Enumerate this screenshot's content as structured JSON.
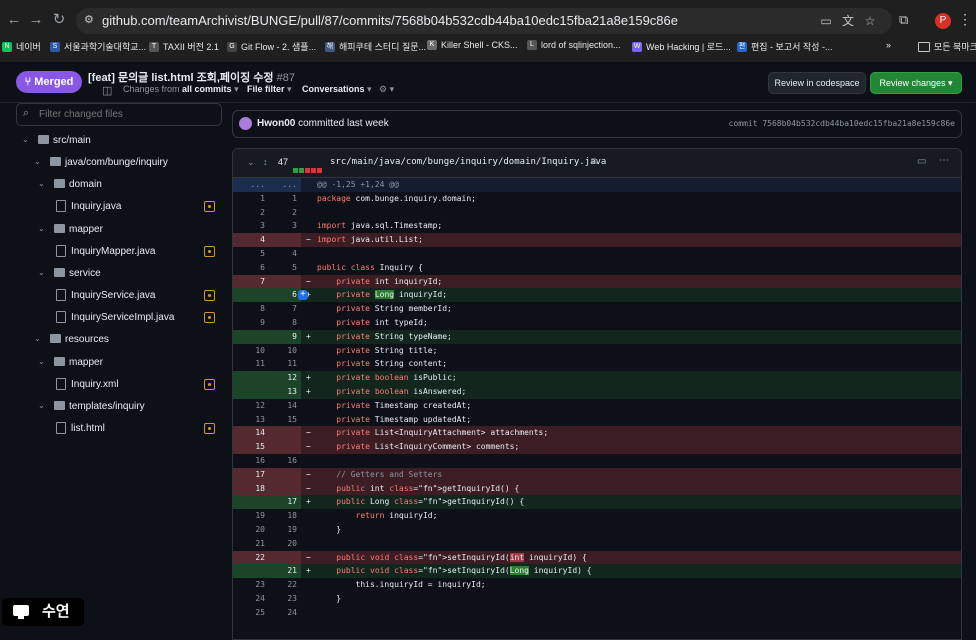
{
  "browser": {
    "url": "github.com/teamArchivist/BUNGE/pull/87/commits/7568b04b532cdb44ba10edc15fba21a8e159c86e",
    "profile_initial": "P",
    "bookmarks": [
      {
        "label": "네이버",
        "color": "#03c75a",
        "icon": "N"
      },
      {
        "label": "서울과학기술대학교...",
        "color": "#2b5aa8",
        "icon": "S"
      },
      {
        "label": "TAXII 버전 2.1",
        "color": "#555555",
        "icon": "T"
      },
      {
        "label": "Git Flow - 2. 샘플...",
        "color": "#444444",
        "icon": "G"
      },
      {
        "label": "해피쿠테 스터디 질문...",
        "color": "#3d5a80",
        "icon": "해"
      },
      {
        "label": "Killer Shell - CKS...",
        "color": "#6b6b6b",
        "icon": "K"
      },
      {
        "label": "lord of sqlinjection...",
        "color": "#555555",
        "icon": "L"
      },
      {
        "label": "Web Hacking | 로드...",
        "color": "#7b61ff",
        "icon": "W"
      },
      {
        "label": "편집 - 보고서 작성 -...",
        "color": "#1e66d0",
        "icon": "편"
      }
    ],
    "bookmarks_more": "»",
    "all_bookmarks": "모든 북마크"
  },
  "pr": {
    "status": "Merged",
    "title": "[feat] 문의글 list.html 조회,페이징 수정",
    "number": "#87",
    "changes_from_prefix": "Changes from",
    "changes_from_value": "all commits",
    "file_filter": "File filter",
    "conversations": "Conversations",
    "review_codespace": "Review in codespace",
    "review_changes": "Review changes"
  },
  "filetree": {
    "filter_placeholder": "Filter changed files",
    "items": [
      {
        "label": "src/main",
        "type": "folder",
        "depth": 0
      },
      {
        "label": "java/com/bunge/inquiry",
        "type": "folder",
        "depth": 1
      },
      {
        "label": "domain",
        "type": "folder",
        "depth": 2
      },
      {
        "label": "Inquiry.java",
        "type": "file",
        "depth": 3
      },
      {
        "label": "mapper",
        "type": "folder",
        "depth": 2
      },
      {
        "label": "InquiryMapper.java",
        "type": "file",
        "depth": 3
      },
      {
        "label": "service",
        "type": "folder",
        "depth": 2
      },
      {
        "label": "InquiryService.java",
        "type": "file",
        "depth": 3
      },
      {
        "label": "InquiryServiceImpl.java",
        "type": "file",
        "depth": 3
      },
      {
        "label": "resources",
        "type": "folder",
        "depth": 1
      },
      {
        "label": "mapper",
        "type": "folder",
        "depth": 2
      },
      {
        "label": "Inquiry.xml",
        "type": "file",
        "depth": 3
      },
      {
        "label": "templates/inquiry",
        "type": "folder",
        "depth": 2
      },
      {
        "label": "list.html",
        "type": "file",
        "depth": 3
      }
    ]
  },
  "commit": {
    "author": "Hwon00",
    "action": "committed last week",
    "sha_label": "commit 7568b04b532cdb44ba10edc15fba21a8e159c86e"
  },
  "file": {
    "change_count": "47",
    "path": "src/main/java/com/bunge/inquiry/domain/Inquiry.java",
    "colors": {
      "added": "#2ea043",
      "removed": "#da3633",
      "neutral": "#30363d"
    }
  },
  "diff": [
    {
      "t": "hunk",
      "o": "...",
      "n": "...",
      "c": "@@ -1,25 +1,24 @@"
    },
    {
      "t": "ctx",
      "o": "1",
      "n": "1",
      "c": "package com.bunge.inquiry.domain;"
    },
    {
      "t": "ctx",
      "o": "2",
      "n": "2",
      "c": ""
    },
    {
      "t": "ctx",
      "o": "3",
      "n": "3",
      "c": "import java.sql.Timestamp;"
    },
    {
      "t": "del",
      "o": "4",
      "n": "",
      "c": "import java.util.List;"
    },
    {
      "t": "ctx",
      "o": "5",
      "n": "4",
      "c": ""
    },
    {
      "t": "ctx",
      "o": "6",
      "n": "5",
      "c": "public class Inquiry {"
    },
    {
      "t": "del",
      "o": "7",
      "n": "",
      "c": "    private int inquiryId;"
    },
    {
      "t": "add",
      "o": "",
      "n": "6",
      "c": "    private Long inquiryId;"
    },
    {
      "t": "ctx",
      "o": "8",
      "n": "7",
      "c": "    private String memberId;"
    },
    {
      "t": "ctx",
      "o": "9",
      "n": "8",
      "c": "    private int typeId;"
    },
    {
      "t": "add",
      "o": "",
      "n": "9",
      "c": "    private String typeName;"
    },
    {
      "t": "ctx",
      "o": "10",
      "n": "10",
      "c": "    private String title;"
    },
    {
      "t": "ctx",
      "o": "11",
      "n": "11",
      "c": "    private String content;"
    },
    {
      "t": "add",
      "o": "",
      "n": "12",
      "c": "    private boolean isPublic;"
    },
    {
      "t": "add",
      "o": "",
      "n": "13",
      "c": "    private boolean isAnswered;"
    },
    {
      "t": "ctx",
      "o": "12",
      "n": "14",
      "c": "    private Timestamp createdAt;"
    },
    {
      "t": "ctx",
      "o": "13",
      "n": "15",
      "c": "    private Timestamp updatedAt;"
    },
    {
      "t": "del",
      "o": "14",
      "n": "",
      "c": "    private List<InquiryAttachment> attachments;"
    },
    {
      "t": "del",
      "o": "15",
      "n": "",
      "c": "    private List<InquiryComment> comments;"
    },
    {
      "t": "ctx",
      "o": "16",
      "n": "16",
      "c": ""
    },
    {
      "t": "del",
      "o": "17",
      "n": "",
      "c": "    // Getters and Setters"
    },
    {
      "t": "del",
      "o": "18",
      "n": "",
      "c": "    public int getInquiryId() {"
    },
    {
      "t": "add",
      "o": "",
      "n": "17",
      "c": "    public Long getInquiryId() {"
    },
    {
      "t": "ctx",
      "o": "19",
      "n": "18",
      "c": "        return inquiryId;"
    },
    {
      "t": "ctx",
      "o": "20",
      "n": "19",
      "c": "    }"
    },
    {
      "t": "ctx",
      "o": "21",
      "n": "20",
      "c": ""
    },
    {
      "t": "del",
      "o": "22",
      "n": "",
      "c": "    public void setInquiryId(int inquiryId) {"
    },
    {
      "t": "add",
      "o": "",
      "n": "21",
      "c": "    public void setInquiryId(Long inquiryId) {"
    },
    {
      "t": "ctx",
      "o": "23",
      "n": "22",
      "c": "        this.inquiryId = inquiryId;"
    },
    {
      "t": "ctx",
      "o": "24",
      "n": "23",
      "c": "    }"
    },
    {
      "t": "ctx",
      "o": "25",
      "n": "24",
      "c": ""
    }
  ],
  "overlay": {
    "label": "수연"
  }
}
